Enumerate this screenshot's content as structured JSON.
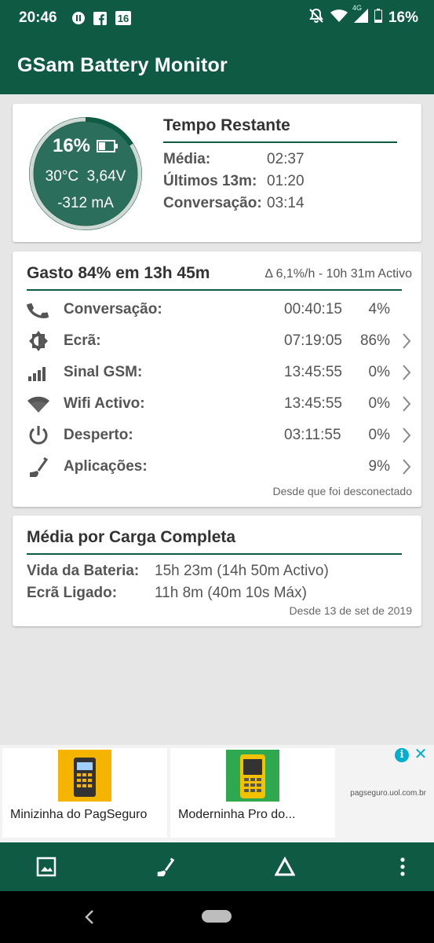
{
  "status_bar": {
    "time": "20:46",
    "notif_badge": "16",
    "network": "4G",
    "battery": "16%"
  },
  "app": {
    "title": "GSam Battery Monitor"
  },
  "summary": {
    "battery_pct": "16%",
    "battery_level": 0.16,
    "temperature": "30°C",
    "voltage": "3,64V",
    "current": "-312 mA",
    "time_remaining": {
      "title": "Tempo Restante",
      "rows": [
        {
          "label": "Média:",
          "value": "02:37"
        },
        {
          "label": "Últimos 13m:",
          "value": "01:20"
        },
        {
          "label": "Conversação:",
          "value": "03:14"
        }
      ]
    }
  },
  "usage": {
    "title": "Gasto 84% em 13h 45m",
    "rate": "Δ 6,1%/h - 10h 31m Activo",
    "rows": [
      {
        "icon": "phone-icon",
        "label": "Conversação:",
        "time": "00:40:15",
        "pct": "4%",
        "has_chevron": false
      },
      {
        "icon": "brightness-icon",
        "label": "Ecrã:",
        "time": "07:19:05",
        "pct": "86%",
        "has_chevron": true
      },
      {
        "icon": "signal-icon",
        "label": "Sinal GSM:",
        "time": "13:45:55",
        "pct": "0%",
        "has_chevron": true
      },
      {
        "icon": "wifi-icon",
        "label": "Wifi Activo:",
        "time": "13:45:55",
        "pct": "0%",
        "has_chevron": true
      },
      {
        "icon": "power-icon",
        "label": "Desperto:",
        "time": "03:11:55",
        "pct": "0%",
        "has_chevron": true
      },
      {
        "icon": "apps-icon",
        "label": "Aplicações:",
        "time": "",
        "pct": "9%",
        "has_chevron": true
      }
    ],
    "since": "Desde que foi desconectado"
  },
  "average": {
    "title": "Média por Carga Completa",
    "rows": [
      {
        "label": "Vida da Bateria:",
        "value": "15h 23m (14h 50m Activo)"
      },
      {
        "label": "Ecrã Ligado:",
        "value": "11h 8m (40m 10s Máx)"
      }
    ],
    "since": "Desde 13 de set de 2019"
  },
  "ad": {
    "items": [
      {
        "text": "Minizinha do PagSeguro"
      },
      {
        "text": "Moderninha Pro do..."
      }
    ],
    "url": "pagseguro.uol.com.br"
  },
  "colors": {
    "primary": "#0e5a43",
    "gauge_fill": "#2b6e5c"
  }
}
